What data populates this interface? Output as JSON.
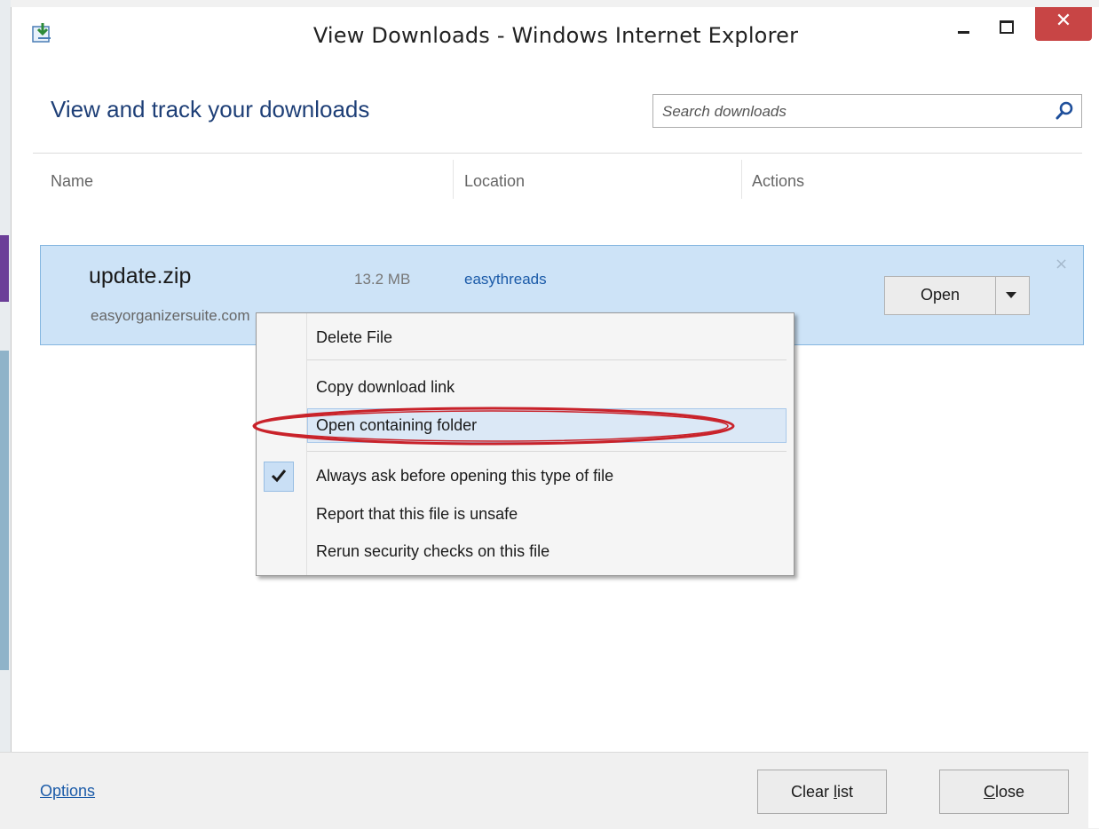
{
  "window": {
    "title": "View Downloads - Windows Internet Explorer",
    "close_glyph": "✕"
  },
  "header": {
    "heading": "View and track your downloads",
    "search_placeholder": "Search downloads"
  },
  "columns": {
    "name": "Name",
    "location": "Location",
    "actions": "Actions"
  },
  "download": {
    "filename": "update.zip",
    "size": "13.2 MB",
    "source": "easyorganizersuite.com",
    "location": "easythreads",
    "open_label": "Open",
    "remove_glyph": "×"
  },
  "context_menu": {
    "items": [
      {
        "label": "Delete File"
      },
      {
        "label": "Copy download link"
      },
      {
        "label": "Open containing folder",
        "highlighted": true
      },
      {
        "label": "Always ask before opening this type of file",
        "checked": true
      },
      {
        "label": "Report that this file is unsafe"
      },
      {
        "label": "Rerun security checks on this file"
      }
    ]
  },
  "footer": {
    "options": "Options",
    "clear_list": {
      "before": "Clear ",
      "accel": "l",
      "after": "ist"
    },
    "close": {
      "accel": "C",
      "after": "lose"
    }
  },
  "colors": {
    "accent": "#1e3f77",
    "link": "#1a5aa8",
    "selected_row": "#cde3f7",
    "close_button": "#c84545",
    "annotation_ellipse": "#c9222a"
  },
  "icons": {
    "app": "ie-downloads-icon",
    "search": "search-icon",
    "check": "check-icon",
    "caret": "caret-down-icon"
  }
}
